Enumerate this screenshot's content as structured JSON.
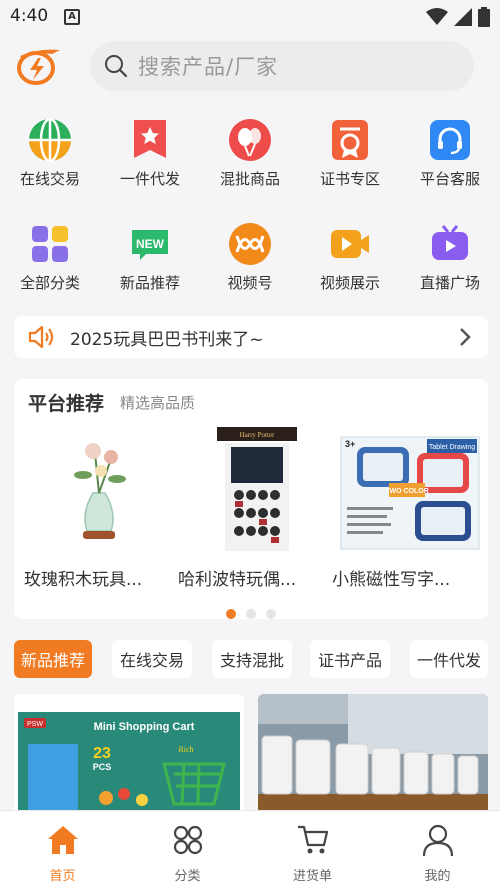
{
  "status_bar": {
    "time": "4:40",
    "notification_icon": "a-icon"
  },
  "search": {
    "placeholder": "搜索产品/厂家"
  },
  "quick_actions": [
    {
      "label": "在线交易",
      "icon": "globe-icon",
      "color": "#2cae5b"
    },
    {
      "label": "一件代发",
      "icon": "star-flag-icon",
      "color": "#ef4f4f"
    },
    {
      "label": "混批商品",
      "icon": "balloons-icon",
      "color": "#ee4b4b"
    },
    {
      "label": "证书专区",
      "icon": "certificate-icon",
      "color": "#f2623a"
    },
    {
      "label": "平台客服",
      "icon": "headset-icon",
      "color": "#2f88f3"
    },
    {
      "label": "全部分类",
      "icon": "grid-icon",
      "color": "#8a70e8"
    },
    {
      "label": "新品推荐",
      "icon": "new-badge-icon",
      "color": "#2bb96b"
    },
    {
      "label": "视频号",
      "icon": "video-channel-icon",
      "color": "#f28a1a"
    },
    {
      "label": "视频展示",
      "icon": "play-icon",
      "color": "#f4a21c"
    },
    {
      "label": "直播广场",
      "icon": "live-tv-icon",
      "color": "#8a5cf0"
    }
  ],
  "notice": {
    "text": "2025玩具巴巴书刊来了~",
    "icon": "speaker-icon"
  },
  "platform_recommend": {
    "title": "平台推荐",
    "subtitle": "精选高品质",
    "products": [
      {
        "name": "玫瑰积木玩具..."
      },
      {
        "name": "哈利波特玩偶..."
      },
      {
        "name": "小熊磁性写字..."
      }
    ],
    "carousel_page": 1,
    "carousel_total": 3
  },
  "filter_tabs": [
    {
      "label": "新品推荐",
      "active": true
    },
    {
      "label": "在线交易",
      "active": false
    },
    {
      "label": "支持混批",
      "active": false
    },
    {
      "label": "证书产品",
      "active": false
    },
    {
      "label": "一件代发",
      "active": false
    }
  ],
  "product_cards": [
    {
      "image_text": "Mini Shopping Cart",
      "count_text": "23",
      "pcs_text": "PCS",
      "brand": "PSW",
      "badge": "Rich"
    },
    {
      "image_text": ""
    }
  ],
  "bottom_nav": [
    {
      "label": "首页",
      "icon": "home-icon",
      "active": true
    },
    {
      "label": "分类",
      "icon": "category-icon",
      "active": false
    },
    {
      "label": "进货单",
      "icon": "cart-icon",
      "active": false
    },
    {
      "label": "我的",
      "icon": "user-icon",
      "active": false
    }
  ],
  "colors": {
    "accent": "#f07b22",
    "background": "#f5f5f7"
  }
}
